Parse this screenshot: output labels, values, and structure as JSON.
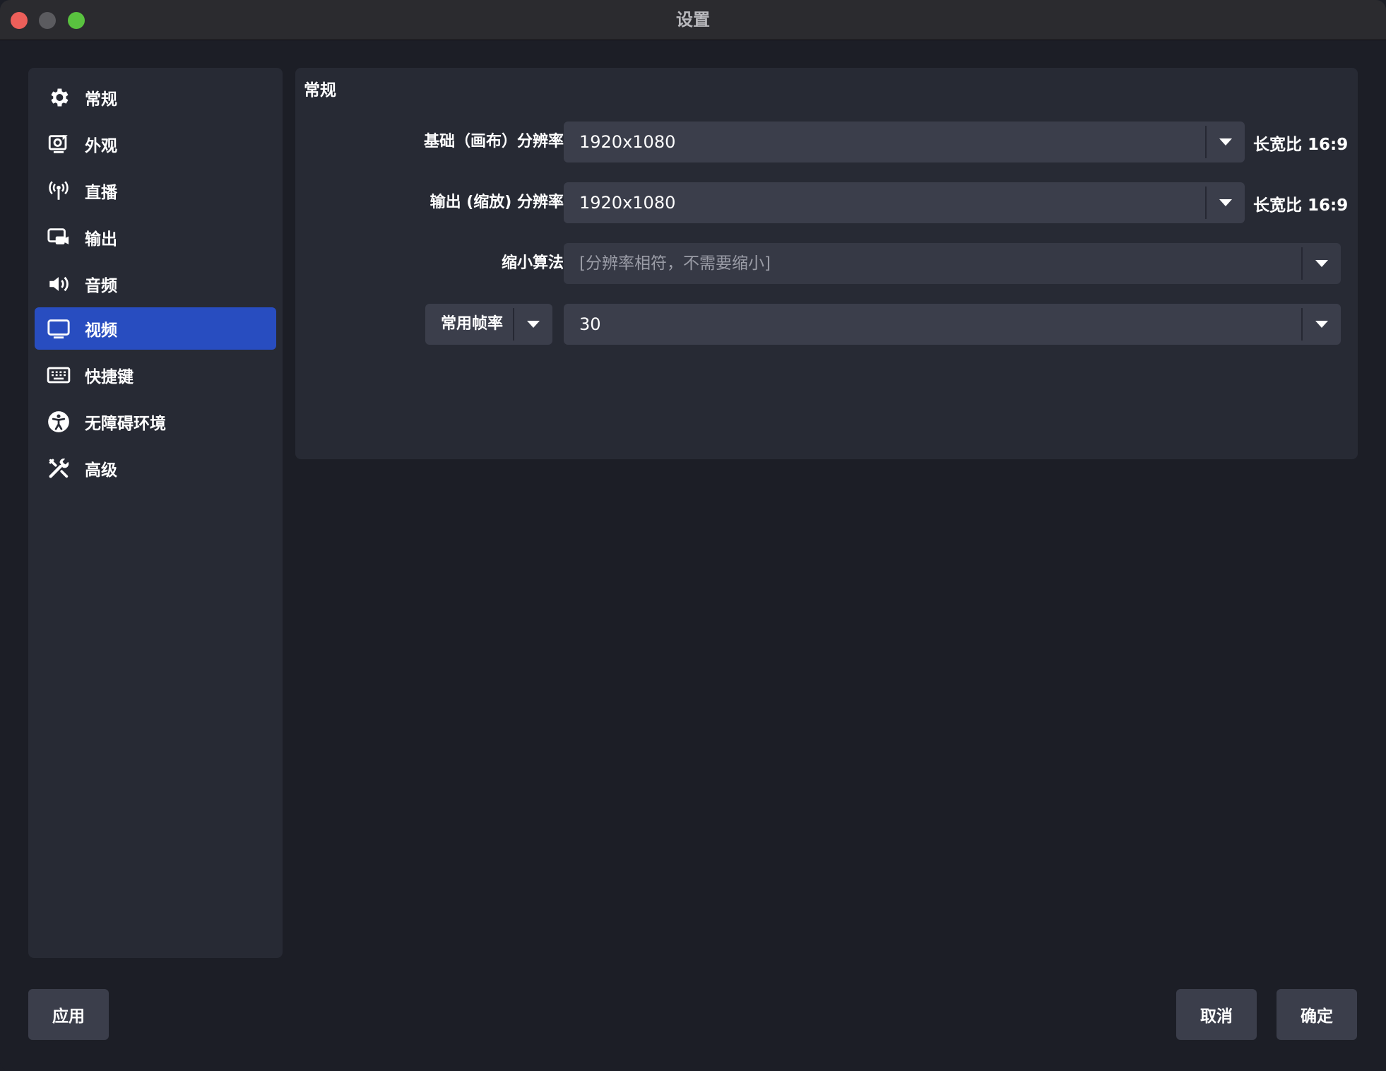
{
  "window": {
    "title": "设置"
  },
  "sidebar": {
    "items": [
      {
        "label": "常规",
        "icon": "gear-icon"
      },
      {
        "label": "外观",
        "icon": "appearance-icon"
      },
      {
        "label": "直播",
        "icon": "antenna-icon"
      },
      {
        "label": "输出",
        "icon": "output-icon"
      },
      {
        "label": "音频",
        "icon": "speaker-icon"
      },
      {
        "label": "视频",
        "icon": "monitor-icon",
        "active": true
      },
      {
        "label": "快捷键",
        "icon": "keyboard-icon"
      },
      {
        "label": "无障碍环境",
        "icon": "accessibility-icon"
      },
      {
        "label": "高级",
        "icon": "tools-icon"
      }
    ]
  },
  "panel": {
    "section_title": "常规",
    "base_resolution": {
      "label": "基础（画布）分辨率",
      "value": "1920x1080",
      "aspect_prefix": "长宽比",
      "aspect_value": "16:9"
    },
    "output_resolution": {
      "label": "输出 (缩放) 分辨率",
      "value": "1920x1080",
      "aspect_prefix": "长宽比",
      "aspect_value": "16:9"
    },
    "downscale_filter": {
      "label": "缩小算法",
      "value": "[分辨率相符，不需要缩小]"
    },
    "fps": {
      "type_value": "常用帧率",
      "value": "30"
    }
  },
  "buttons": {
    "apply": "应用",
    "cancel": "取消",
    "ok": "确定"
  },
  "colors": {
    "accent": "#284dc0",
    "background": "#1c1e26",
    "panel": "#272a34",
    "control": "#3b3e4b"
  }
}
